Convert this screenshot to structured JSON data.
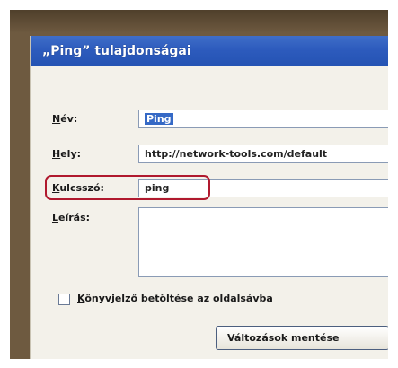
{
  "dialog": {
    "title": "„Ping” tulajdonságai",
    "fields": {
      "name": {
        "label_first": "N",
        "label_rest": "év:",
        "value": "Ping"
      },
      "location": {
        "label_first": "H",
        "label_rest": "ely:",
        "value": "http://network-tools.com/default"
      },
      "keyword": {
        "label_first": "K",
        "label_rest": "ulcsszó:",
        "value": "ping"
      },
      "description": {
        "label_first": "L",
        "label_rest": "eírás:",
        "value": ""
      }
    },
    "sidebar_checkbox": {
      "label_first": "K",
      "label_rest": "önyvjelző betöltése az oldalsávba",
      "checked": false
    },
    "save_button": {
      "label": "Változások mentése"
    }
  },
  "colors": {
    "title_bar": "#2d5bbd",
    "highlight": "#b0192e",
    "selection": "#3569c6"
  }
}
